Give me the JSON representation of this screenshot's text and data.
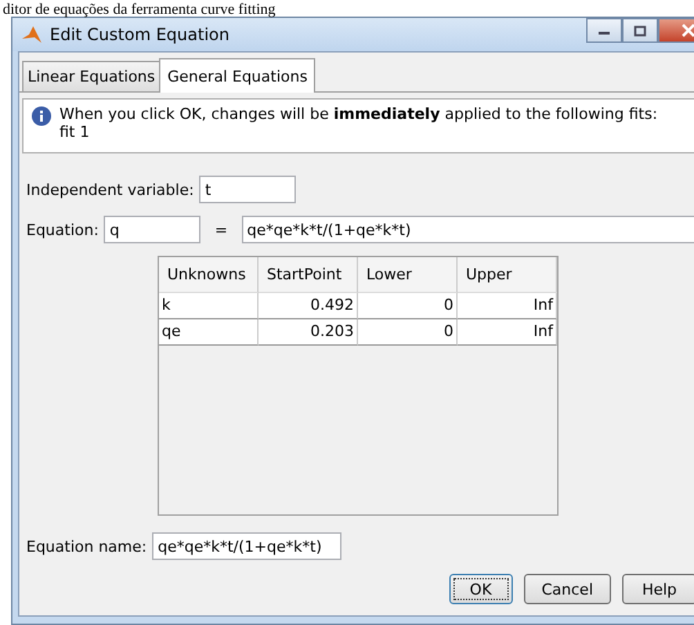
{
  "document_caption": "ditor de equações da ferramenta curve fitting",
  "window": {
    "title": "Edit Custom Equation"
  },
  "tabs": [
    {
      "label": "Linear Equations",
      "selected": false
    },
    {
      "label": "General Equations",
      "selected": true
    }
  ],
  "info": {
    "message": "When you click OK, changes will be **immediately** applied to the following fits:",
    "fits": "fit 1"
  },
  "independent_variable": {
    "label": "Independent variable:",
    "value": "t"
  },
  "equation": {
    "label": "Equation:",
    "lhs": "q",
    "equals": "=",
    "rhs": "qe*qe*k*t/(1+qe*k*t)"
  },
  "table": {
    "columns": [
      "Unknowns",
      "StartPoint",
      "Lower",
      "Upper"
    ],
    "rows": [
      [
        "k",
        "0.492",
        "0",
        "Inf"
      ],
      [
        "qe",
        "0.203",
        "0",
        "Inf"
      ]
    ]
  },
  "equation_name": {
    "label": "Equation name:",
    "value": "qe*qe*k*t/(1+qe*k*t)"
  },
  "buttons": [
    {
      "label": "OK",
      "default": true
    },
    {
      "label": "Cancel",
      "default": false
    },
    {
      "label": "Help",
      "default": false
    }
  ]
}
